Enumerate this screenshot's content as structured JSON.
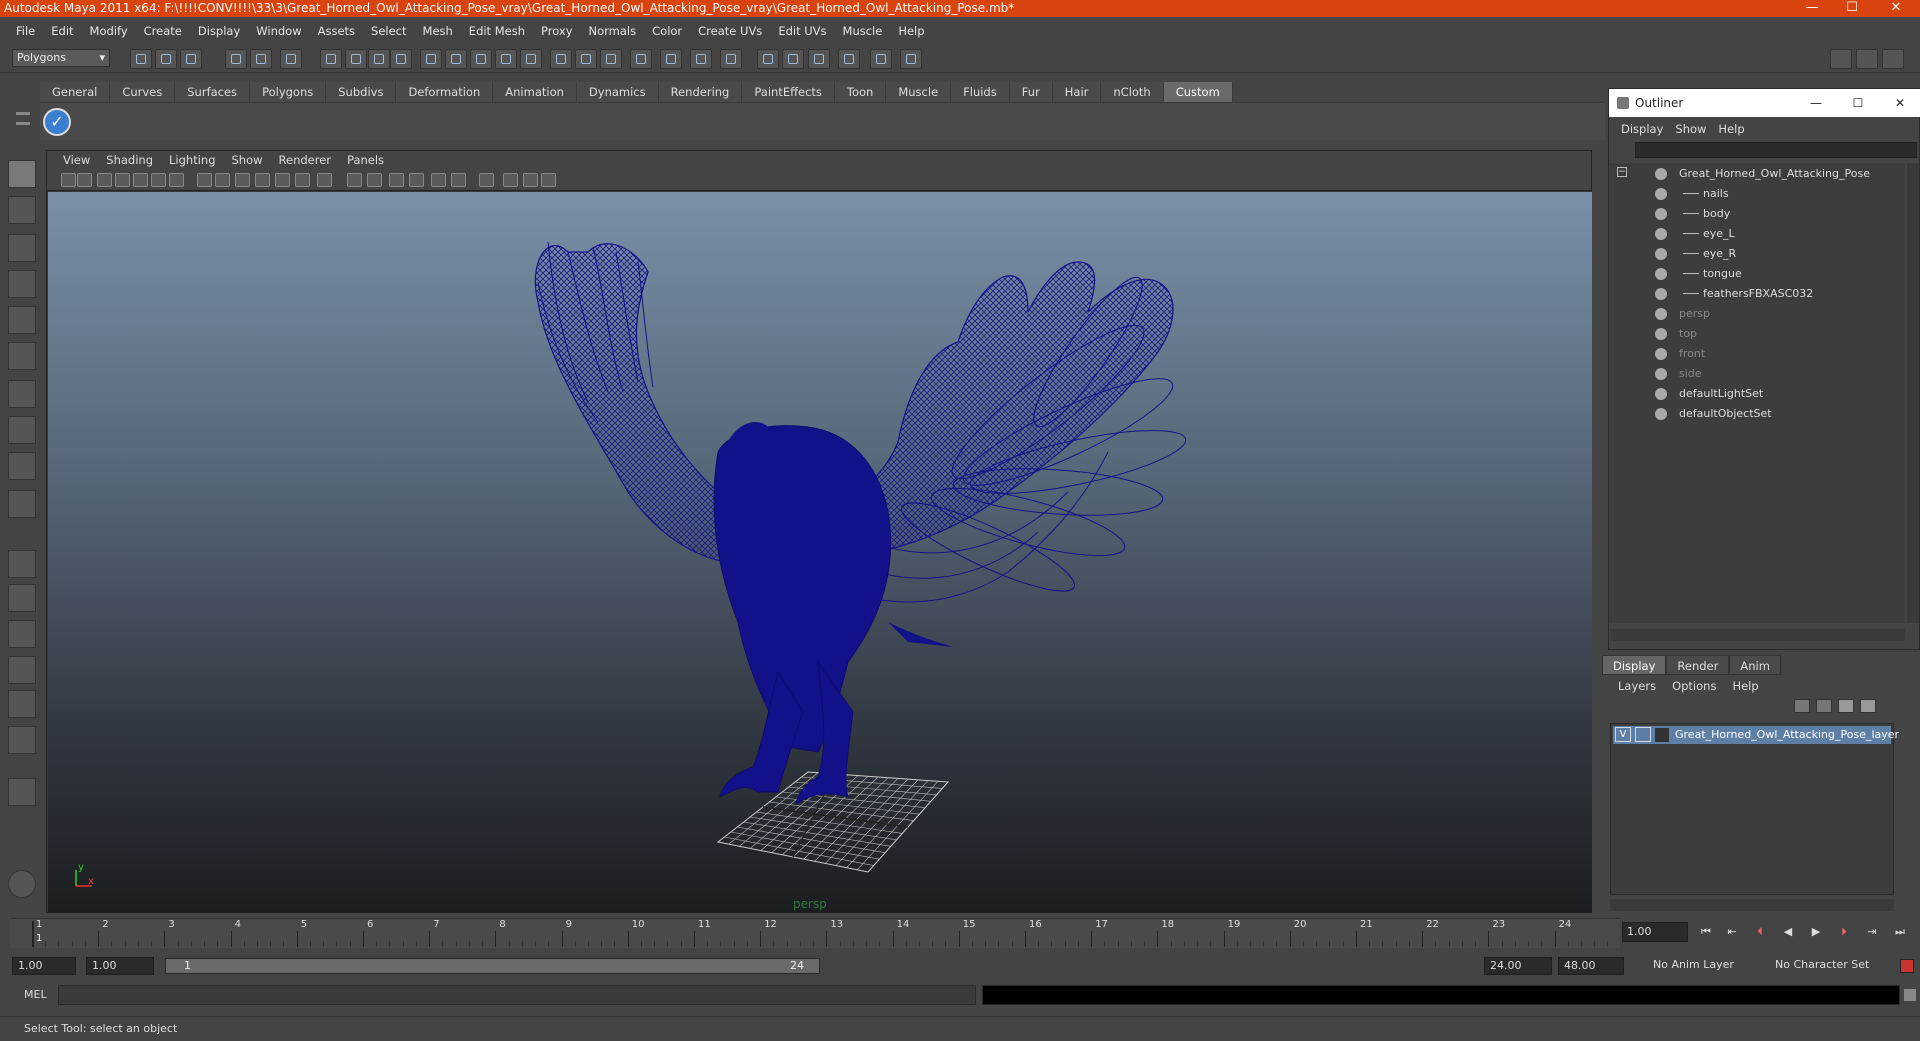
{
  "title_bar": {
    "title": "Autodesk Maya 2011 x64: F:\\!!!!CONV!!!!\\33\\3\\Great_Horned_Owl_Attacking_Pose_vray\\Great_Horned_Owl_Attacking_Pose_vray\\Great_Horned_Owl_Attacking_Pose.mb*",
    "minimize": "—",
    "maximize": "☐",
    "close": "✕"
  },
  "menu": [
    "File",
    "Edit",
    "Modify",
    "Create",
    "Display",
    "Window",
    "Assets",
    "Select",
    "Mesh",
    "Edit Mesh",
    "Proxy",
    "Normals",
    "Color",
    "Create UVs",
    "Edit UVs",
    "Muscle",
    "Help"
  ],
  "status_line": {
    "mode": "Polygons"
  },
  "shelf": {
    "tabs": [
      "General",
      "Curves",
      "Surfaces",
      "Polygons",
      "Subdivs",
      "Deformation",
      "Animation",
      "Dynamics",
      "Rendering",
      "PaintEffects",
      "Toon",
      "Muscle",
      "Fluids",
      "Fur",
      "Hair",
      "nCloth",
      "Custom"
    ],
    "active_tab": "Custom"
  },
  "viewport": {
    "menu": [
      "View",
      "Shading",
      "Lighting",
      "Show",
      "Renderer",
      "Panels"
    ],
    "camera_label": "persp",
    "axis_x": "x",
    "axis_y": "y",
    "wire_color": "#12107a"
  },
  "timeline": {
    "ticks": [
      "1",
      "2",
      "3",
      "4",
      "5",
      "6",
      "7",
      "8",
      "9",
      "10",
      "11",
      "12",
      "13",
      "14",
      "15",
      "16",
      "17",
      "18",
      "19",
      "20",
      "21",
      "22",
      "23",
      "24"
    ],
    "current_frame": "1.00",
    "current_marker": "1"
  },
  "range": {
    "start": "1.00",
    "start2": "1.00",
    "slider_start": "1",
    "slider_end": "24",
    "end": "24.00",
    "end2": "48.00",
    "anim_layer": "No Anim Layer",
    "char_set": "No Character Set"
  },
  "command_line": {
    "label": "MEL"
  },
  "help_line": {
    "text": "Select Tool: select an object"
  },
  "outliner": {
    "title": "Outliner",
    "menu": [
      "Display",
      "Show",
      "Help"
    ],
    "items": [
      {
        "label": "Great_Horned_Owl_Attacking_Pose",
        "indent": 0,
        "dim": false
      },
      {
        "label": "nails",
        "indent": 1,
        "dim": false
      },
      {
        "label": "body",
        "indent": 1,
        "dim": false
      },
      {
        "label": "eye_L",
        "indent": 1,
        "dim": false
      },
      {
        "label": "eye_R",
        "indent": 1,
        "dim": false
      },
      {
        "label": "tongue",
        "indent": 1,
        "dim": false
      },
      {
        "label": "feathersFBXASC032",
        "indent": 1,
        "dim": false
      },
      {
        "label": "persp",
        "indent": 0,
        "dim": true
      },
      {
        "label": "top",
        "indent": 0,
        "dim": true
      },
      {
        "label": "front",
        "indent": 0,
        "dim": true
      },
      {
        "label": "side",
        "indent": 0,
        "dim": true
      },
      {
        "label": "defaultLightSet",
        "indent": 0,
        "dim": false
      },
      {
        "label": "defaultObjectSet",
        "indent": 0,
        "dim": false
      }
    ]
  },
  "layers": {
    "tabs": [
      "Display",
      "Render",
      "Anim"
    ],
    "active_tab": "Display",
    "menu": [
      "Layers",
      "Options",
      "Help"
    ],
    "visible_flag": "V",
    "layer_name": "Great_Horned_Owl_Attacking_Pose_layer"
  }
}
